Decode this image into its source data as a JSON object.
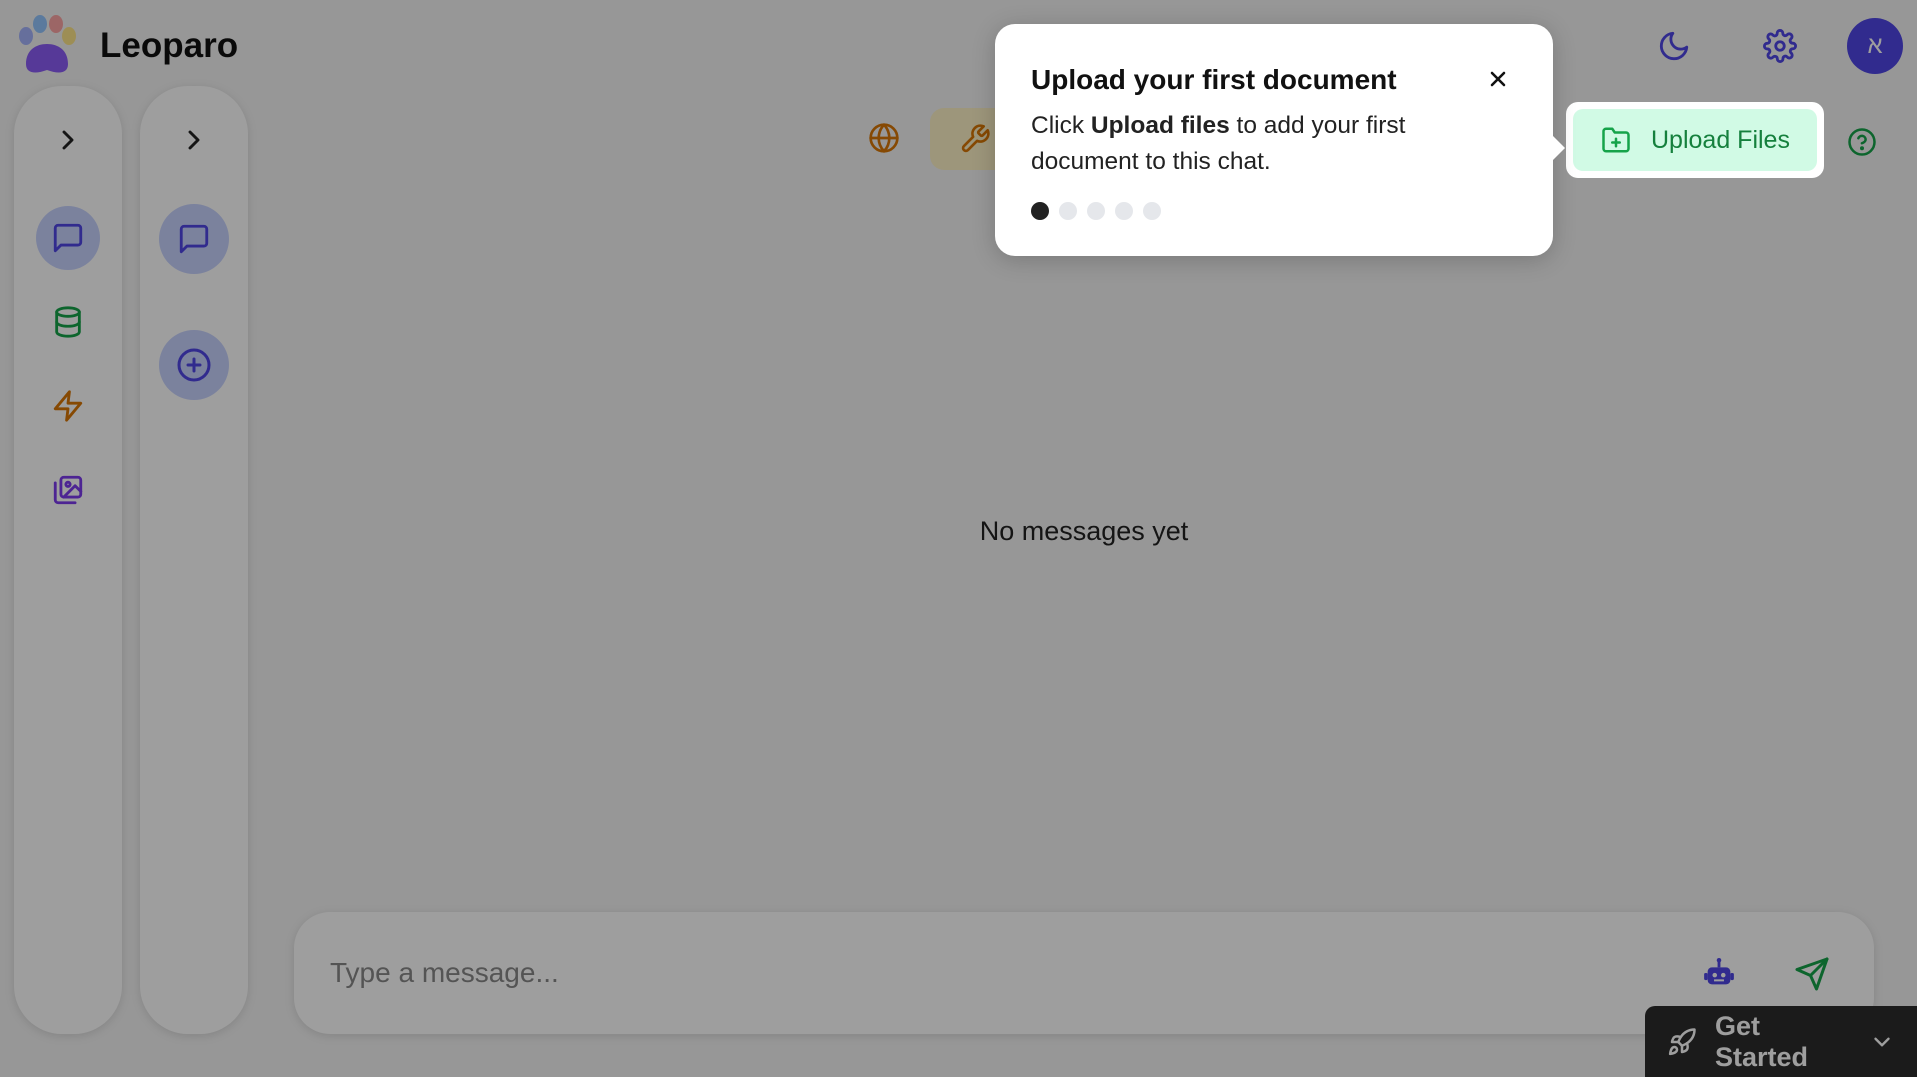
{
  "app": {
    "name": "Leoparo"
  },
  "header": {
    "avatar_initial": "א",
    "icons": [
      "moon-icon",
      "gear-icon"
    ]
  },
  "sidebar_primary": {
    "items": [
      {
        "icon": "message-square-icon",
        "active": true
      },
      {
        "icon": "database-icon"
      },
      {
        "icon": "lightning-icon"
      },
      {
        "icon": "images-icon"
      }
    ]
  },
  "sidebar_secondary": {
    "items": [
      {
        "icon": "message-square-icon",
        "active": true
      },
      {
        "icon": "plus-circle-icon"
      }
    ]
  },
  "toolbar": {
    "upload_label": "Upload Files",
    "icons": [
      "globe-icon",
      "wrench-icon",
      "help-circle-icon"
    ]
  },
  "main": {
    "empty_message": "No messages yet"
  },
  "composer": {
    "placeholder": "Type a message..."
  },
  "get_started": {
    "label": "Get Started"
  },
  "tour": {
    "title": "Upload your first document",
    "body_prefix": "Click ",
    "body_bold": "Upload files",
    "body_suffix": " to add your first document to this chat.",
    "total_steps": 5,
    "current_step": 1
  },
  "colors": {
    "accent": "#4f46e5",
    "upload_bg": "#d1fae5",
    "upload_text": "#15803d",
    "database": "#16a34a",
    "lightning": "#d97706",
    "images": "#7c3aed",
    "globe": "#d97706"
  }
}
